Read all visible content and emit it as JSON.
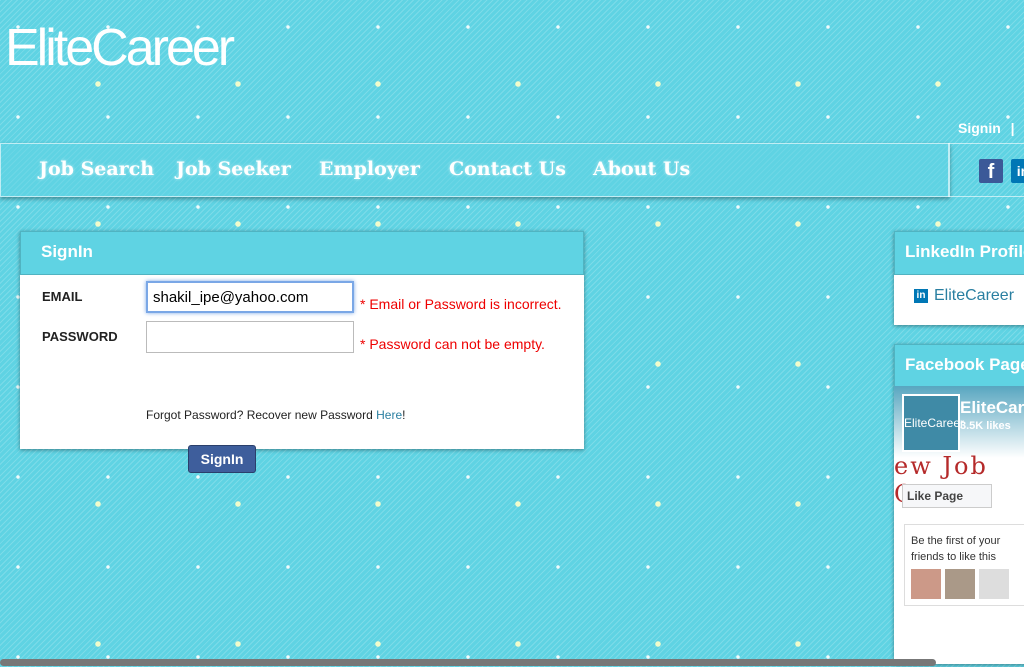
{
  "logo": "EliteCareer",
  "top_links": [
    "Signin",
    "|"
  ],
  "nav": [
    "Job Search",
    "Job Seeker",
    "Employer",
    "Contact Us",
    "About Us"
  ],
  "social": {
    "facebook": "f",
    "linkedin": "in"
  },
  "signin": {
    "title": "SignIn",
    "email_label": "EMAIL",
    "email_value": "shakil_ipe@yahoo.com",
    "email_error": "* Email or Password is incorrect.",
    "password_label": "PASSWORD",
    "password_value": "",
    "password_error": "* Password can not be empty.",
    "forgot_text": "Forgot Password? Recover new Password",
    "forgot_link": "Here",
    "forgot_suffix": "!",
    "button": "SignIn"
  },
  "linkedin_panel": {
    "title": "LinkedIn Profile",
    "link": "EliteCareer",
    "icon": "in"
  },
  "facebook_panel": {
    "title": "Facebook Page",
    "thumb": "EliteCareer",
    "page_name": "EliteCareer",
    "likes": "3.5K likes",
    "banner": "ew Job Op",
    "like_button": "Like Page",
    "friends_text": "Be the first of your friends to like this"
  }
}
